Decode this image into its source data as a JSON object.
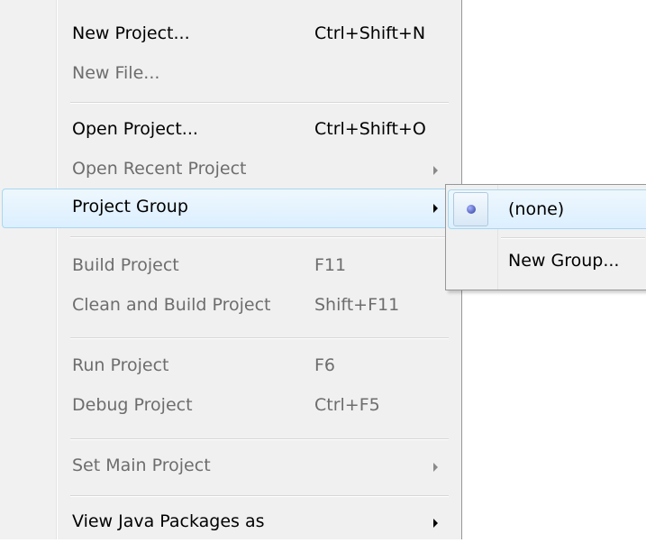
{
  "menu": {
    "items": [
      {
        "label": "New Project...",
        "accel": "Ctrl+Shift+N",
        "enabled": true
      },
      {
        "label": "New File...",
        "accel": "",
        "enabled": false
      },
      {
        "label": "Open Project...",
        "accel": "Ctrl+Shift+O",
        "enabled": true
      },
      {
        "label": "Open Recent Project",
        "accel": "",
        "enabled": false,
        "submenu": true
      },
      {
        "label": "Project Group",
        "accel": "",
        "enabled": true,
        "submenu": true,
        "highlighted": true
      },
      {
        "label": "Build Project",
        "accel": "F11",
        "enabled": false
      },
      {
        "label": "Clean and Build Project",
        "accel": "Shift+F11",
        "enabled": false
      },
      {
        "label": "Run Project",
        "accel": "F6",
        "enabled": false
      },
      {
        "label": "Debug Project",
        "accel": "Ctrl+F5",
        "enabled": false
      },
      {
        "label": "Set Main Project",
        "accel": "",
        "enabled": false,
        "submenu": true
      },
      {
        "label": "View Java Packages as",
        "accel": "",
        "enabled": true,
        "submenu": true
      }
    ]
  },
  "submenu": {
    "items": [
      {
        "label": "(none)",
        "selected": true
      },
      {
        "label": "New Group..."
      }
    ]
  },
  "colors": {
    "highlight_border": "#a7d8f0",
    "menu_bg": "#f0f0f0",
    "disabled_text": "#6d6d6d",
    "radio_dot": "#2b3a9a"
  }
}
